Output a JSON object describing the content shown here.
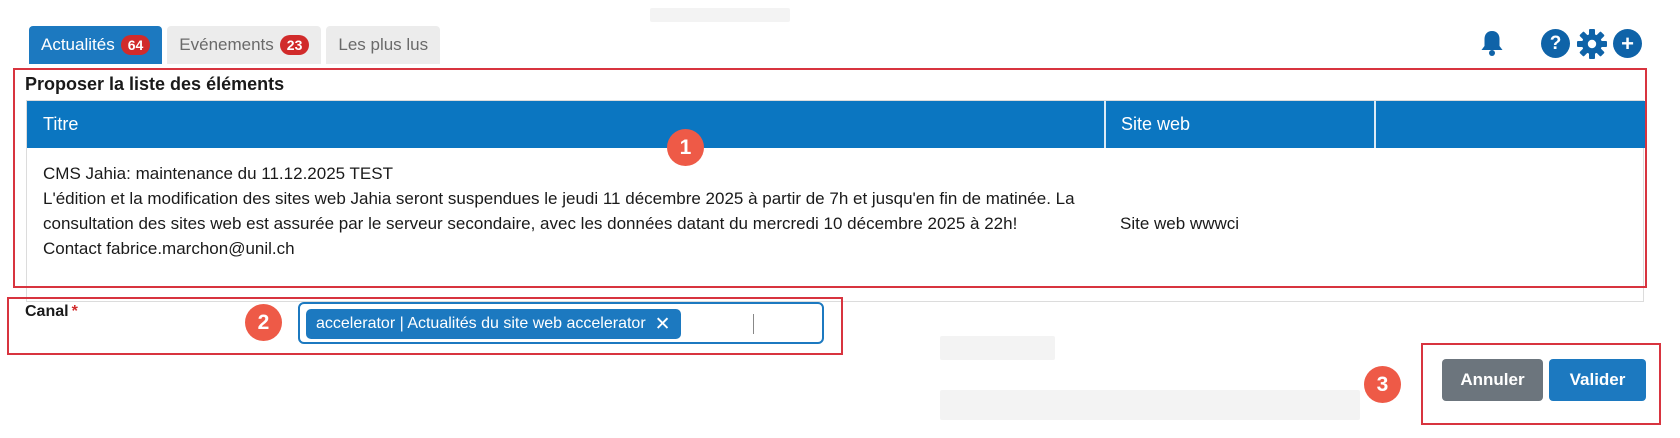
{
  "tabs": [
    {
      "label": "Actualités",
      "badge": "64",
      "active": true
    },
    {
      "label": "Evénements",
      "badge": "23",
      "active": false
    },
    {
      "label": "Les plus lus",
      "badge": "",
      "active": false
    }
  ],
  "toolbar_icons": {
    "notifications": "bell-icon",
    "help": "?",
    "settings": "gear-icon",
    "add": "+"
  },
  "section": {
    "title": "Proposer la liste des éléments"
  },
  "table": {
    "headers": [
      "Titre",
      "Site web",
      ""
    ],
    "rows": [
      {
        "title_line": "CMS Jahia: maintenance du 11.12.2025 TEST",
        "body": "L'édition et la modification des sites web Jahia seront suspendues le jeudi 11 décembre 2025 à partir de 7h et jusqu'en fin de matinée. La consultation des sites web est assurée par le serveur secondaire, avec les données datant du mercredi 10 décembre 2025 à 22h!",
        "contact": "Contact fabrice.marchon@unil.ch",
        "site": "Site web wwwci"
      }
    ]
  },
  "canal": {
    "label": "Canal",
    "required_mark": "*",
    "chip": "accelerator | Actualités du site web accelerator",
    "chip_remove": "✕"
  },
  "buttons": {
    "cancel": "Annuler",
    "confirm": "Valider"
  },
  "annotations": [
    "1",
    "2",
    "3"
  ],
  "colors": {
    "primary": "#1c79c0",
    "header": "#0b76c1",
    "badge": "#d12b2b",
    "cancel": "#6c757d",
    "annotation": "#d8343f"
  }
}
